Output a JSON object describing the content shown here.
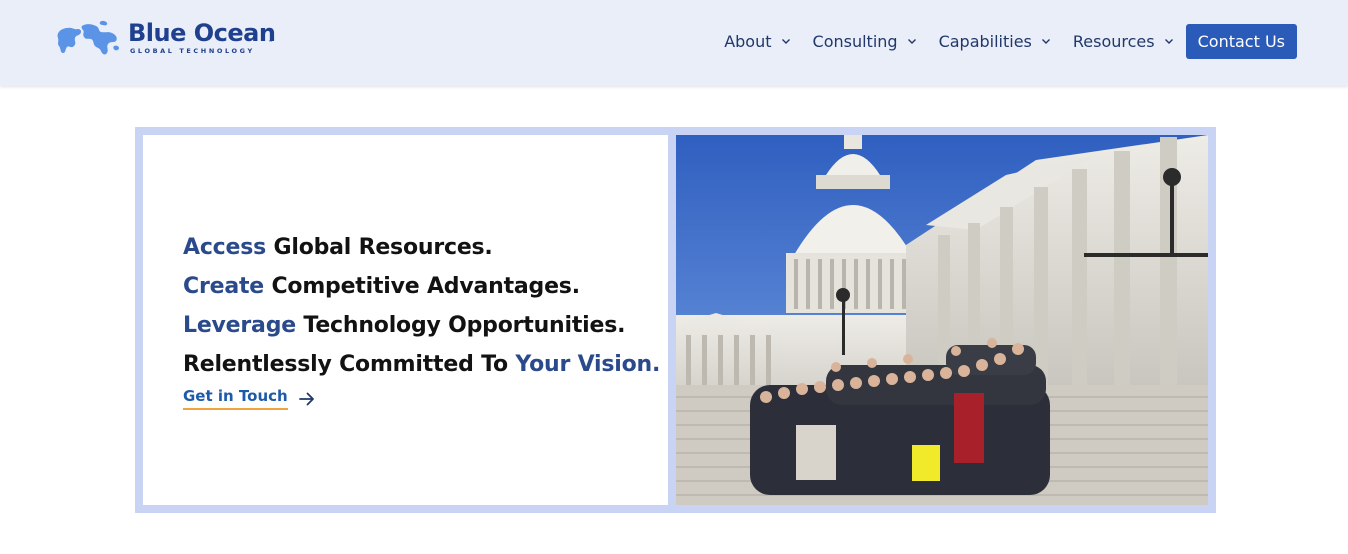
{
  "brand": {
    "name": "Blue Ocean",
    "tagline": "GLOBAL TECHNOLOGY",
    "trademark": "™"
  },
  "nav": {
    "items": [
      {
        "label": "About",
        "icon": "chevron-down-icon"
      },
      {
        "label": "Consulting",
        "icon": "chevron-down-icon"
      },
      {
        "label": "Capabilities",
        "icon": "chevron-down-icon"
      },
      {
        "label": "Resources",
        "icon": "chevron-down-icon"
      }
    ],
    "contact_label": "Contact Us"
  },
  "hero": {
    "lines": [
      {
        "accent": "Access",
        "rest": " Global Resources."
      },
      {
        "accent": "Create",
        "rest": " Competitive Advantages."
      },
      {
        "accent": "Leverage",
        "rest": " Technology Opportunities."
      }
    ],
    "last_line_prefix": "Relentlessly Committed To ",
    "last_line_accent": "Your Vision.",
    "cta_label": "Get in Touch",
    "cta_icon": "arrow-right-icon",
    "image": "group-photo-capitol-steps"
  },
  "colors": {
    "accent_text": "#2a4a8c",
    "button": "#2a5bb8",
    "cta_underline": "#f0a33c",
    "frame": "#c9d3f3",
    "header_bg": "#e9eef8"
  }
}
